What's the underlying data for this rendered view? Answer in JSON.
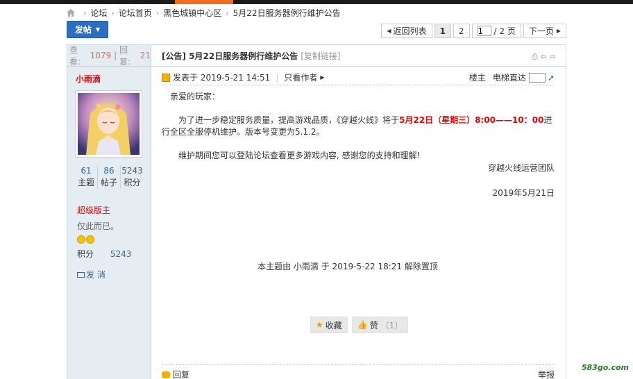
{
  "breadcrumb": {
    "items": [
      "论坛",
      "论坛首页",
      "黑色城镇中心区",
      "5月22日服务器例行维护公告"
    ]
  },
  "toolbar": {
    "post_label": "发帖"
  },
  "pager": {
    "back": "返回列表",
    "pages": [
      "1",
      "2"
    ],
    "current_input": "1",
    "total": "/ 2 页",
    "next": "下一页"
  },
  "thread_stats": {
    "views_label": "查看:",
    "views": "1079",
    "replies_label": "回复:",
    "replies": "21"
  },
  "author": {
    "name": "小雨滴",
    "topics": "61",
    "topics_label": "主题",
    "posts": "86",
    "posts_label": "帖子",
    "credits": "5243",
    "credits_label": "积分",
    "rank": "超级版主",
    "signature": "仅此而已。",
    "credit_label": "积分",
    "credit_value": "5243",
    "pm_label": "发 消",
    "medal_count": 2
  },
  "post": {
    "title": "[公告] 5月22日服务器例行维护公告",
    "copy_link": "[复制链接]",
    "posted_at": "发表于 2019-5-21 14:51",
    "only_author": "只看作者",
    "floor": "楼主",
    "jump_label": "电梯直达",
    "greeting": "亲爱的玩家：",
    "body_pre": "为了进一步稳定服务质量，提高游戏品质，《穿越火线》将于",
    "body_highlight": "5月22日（星期三）8:00——10：00",
    "body_post": "进行全区全服停机维护。版本号变更为5.1.2。",
    "body2": "维护期间您可以登陆论坛查看更多游戏内容, 感谢您的支持和理解!",
    "signoff": "穿越火线运营团队",
    "date": "2019年5月21日",
    "admin_note": "本主题由 小雨滴 于 2019-5-22 18:21 解除置顶",
    "favorite_label": "收藏",
    "like_label": "赞",
    "like_count": "（1）",
    "reply_label": "回复",
    "report_label": "举报"
  },
  "watermark": "583go.com",
  "colors": {
    "accent": "#f26d1e",
    "link": "#336699",
    "highlight": "#e00000",
    "button": "#2c6fc0"
  }
}
